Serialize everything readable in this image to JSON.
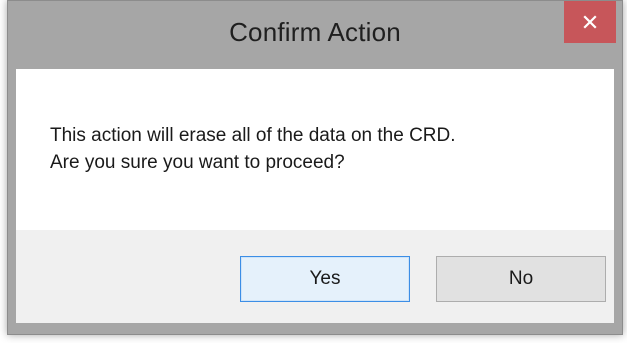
{
  "dialog": {
    "title": "Confirm Action",
    "close_icon": "close-icon",
    "message_lines": [
      "This action will erase all of the data on the CRD.",
      "Are you sure you want to proceed?"
    ],
    "buttons": {
      "yes_label": "Yes",
      "no_label": "No"
    },
    "colors": {
      "titlebar": "#a6a6a6",
      "close_button": "#c7565a",
      "default_button_border": "#3c8ee6",
      "button_bar": "#f0f0f0"
    }
  }
}
